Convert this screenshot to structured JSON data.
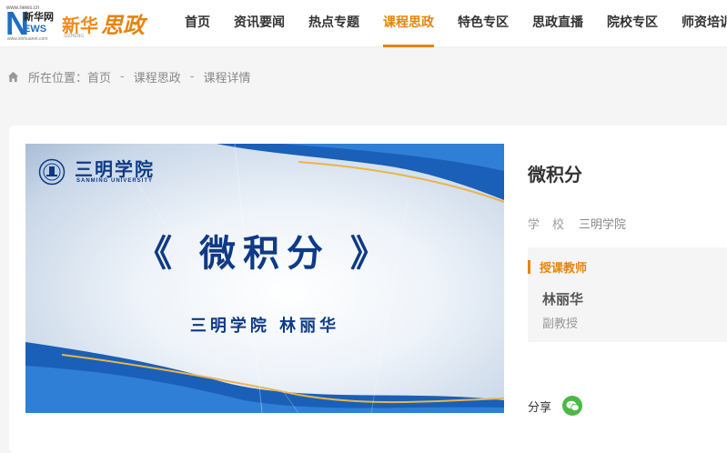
{
  "logo": {
    "n_letter": "N",
    "news_small": "www.news.cn",
    "cn_site": "新华网",
    "news_word": "EWS",
    "site_url": "www.xinhuanet.com",
    "brand_xh": "新华",
    "brand_sz": "思政",
    "brand_sub": "SIZHENG"
  },
  "nav": {
    "items": [
      {
        "label": "首页",
        "active": false
      },
      {
        "label": "资讯要闻",
        "active": false
      },
      {
        "label": "热点专题",
        "active": false
      },
      {
        "label": "课程思政",
        "active": true
      },
      {
        "label": "特色专区",
        "active": false
      },
      {
        "label": "思政直播",
        "active": false
      },
      {
        "label": "院校专区",
        "active": false
      },
      {
        "label": "师资培训",
        "active": false
      }
    ]
  },
  "breadcrumb": {
    "prefix": "所在位置：",
    "items": [
      "首页",
      "课程思政",
      "课程详情"
    ],
    "separator": "-"
  },
  "video": {
    "school_cn": "三明学院",
    "school_en": "SANMING UNIVERSITY",
    "title": "《 微积分 》",
    "subtitle": "三明学院  林丽华"
  },
  "detail": {
    "title": "微积分",
    "school_label": "学校",
    "school_value": "三明学院",
    "teacher_heading": "授课教师",
    "teacher_name": "林丽华",
    "teacher_rank": "副教授",
    "share_label": "分享"
  },
  "colors": {
    "accent": "#e8830f",
    "brand_blue": "#1e6fc1",
    "wechat_green": "#4cb848",
    "video_title_blue": "#0e3a86"
  },
  "icons": {
    "home": "home-icon",
    "wechat": "wechat-icon",
    "school_emblem": "school-emblem-icon"
  }
}
